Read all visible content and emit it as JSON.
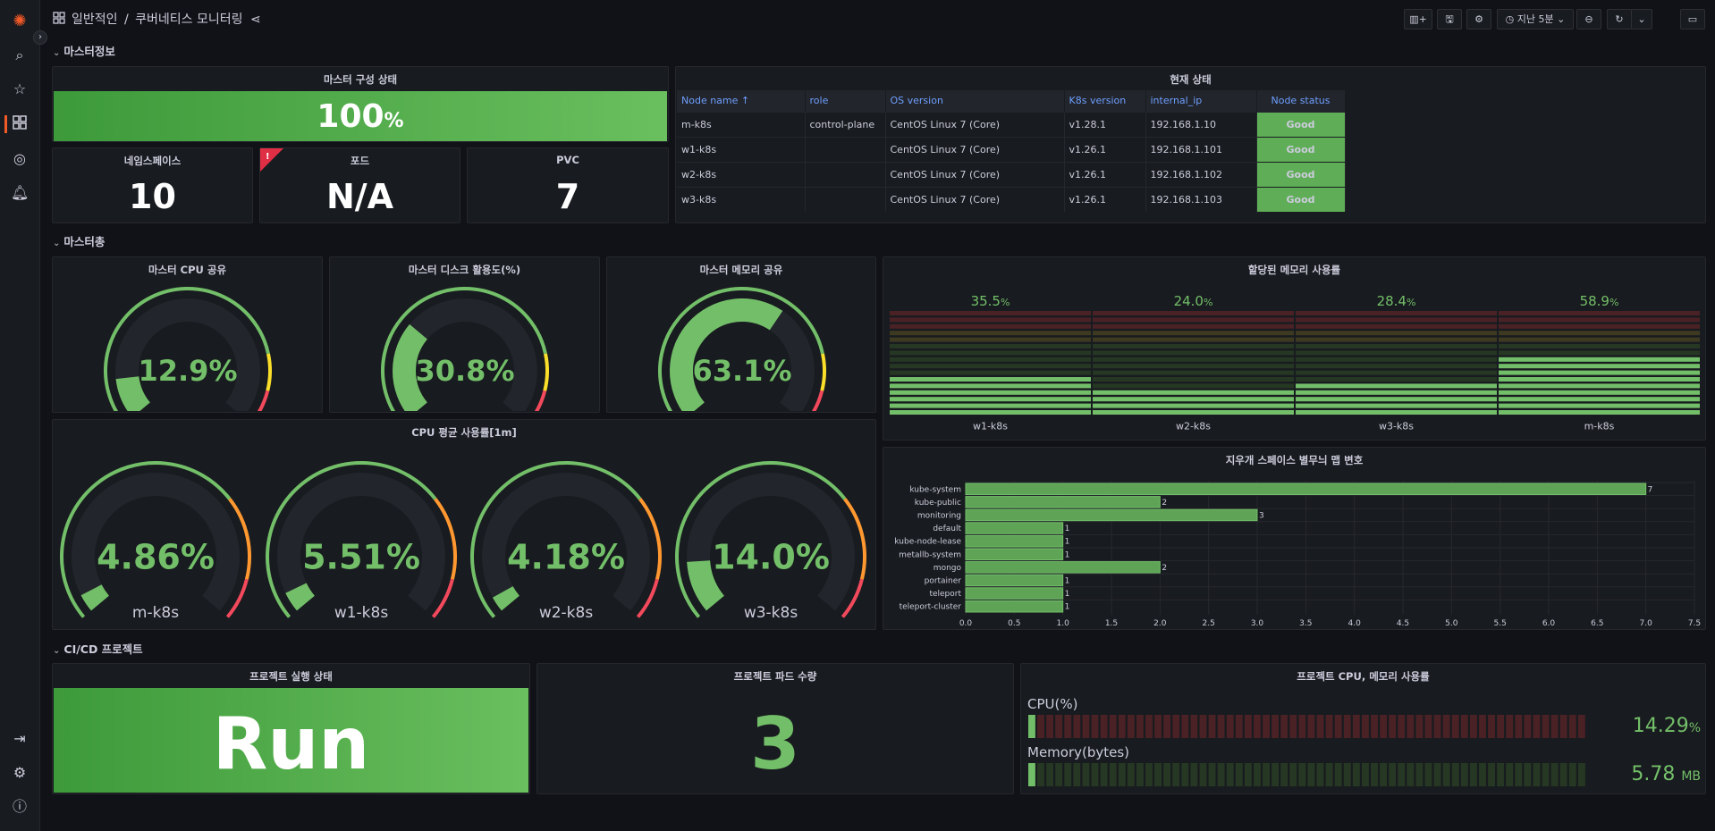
{
  "breadcrumb": {
    "folder": "일반적인",
    "separator": "/",
    "dashboard": "쿠버네티스 모니터링"
  },
  "toolbar": {
    "time_range": "지난 5분"
  },
  "rows": {
    "master_info": "마스터정보",
    "master_total": "마스터총",
    "cicd": "CI/CD 프로젝트"
  },
  "master_status": {
    "title": "마스터 구성 상태",
    "value": "100",
    "unit": "%"
  },
  "namespace": {
    "title": "네임스페이스",
    "value": "10"
  },
  "pod": {
    "title": "포드",
    "value": "N/A"
  },
  "pvc": {
    "title": "PVC",
    "value": "7"
  },
  "current_status": {
    "title": "현재 상태",
    "columns": [
      "Node name ↑",
      "role",
      "OS version",
      "K8s version",
      "internal_ip",
      "Node status"
    ],
    "rows": [
      [
        "m-k8s",
        "control-plane",
        "CentOS Linux 7 (Core)",
        "v1.28.1",
        "192.168.1.10",
        "Good"
      ],
      [
        "w1-k8s",
        "",
        "CentOS Linux 7 (Core)",
        "v1.26.1",
        "192.168.1.101",
        "Good"
      ],
      [
        "w2-k8s",
        "",
        "CentOS Linux 7 (Core)",
        "v1.26.1",
        "192.168.1.102",
        "Good"
      ],
      [
        "w3-k8s",
        "",
        "CentOS Linux 7 (Core)",
        "v1.26.1",
        "192.168.1.103",
        "Good"
      ]
    ]
  },
  "gauges_small": [
    {
      "title": "마스터 CPU 공유",
      "value": 12.9,
      "label": "12.9%"
    },
    {
      "title": "마스터 디스크 활용도(%)",
      "value": 30.8,
      "label": "30.8%"
    },
    {
      "title": "마스터 메모리 공유",
      "value": 63.1,
      "label": "63.1%"
    }
  ],
  "cpu_avg": {
    "title": "CPU 평균 사용률[1m]",
    "gauges": [
      {
        "value": 4.86,
        "label": "4.86%",
        "name": "m-k8s"
      },
      {
        "value": 5.51,
        "label": "5.51%",
        "name": "w1-k8s"
      },
      {
        "value": 4.18,
        "label": "4.18%",
        "name": "w2-k8s"
      },
      {
        "value": 14.0,
        "label": "14.0%",
        "name": "w3-k8s"
      }
    ]
  },
  "mem_alloc": {
    "title": "할당된 메모리 사용률",
    "bars": [
      {
        "name": "w1-k8s",
        "value": 35.5,
        "num": "35.5",
        "unit": "%"
      },
      {
        "name": "w2-k8s",
        "value": 24.0,
        "num": "24.0",
        "unit": "%"
      },
      {
        "name": "w3-k8s",
        "value": 28.4,
        "num": "28.4",
        "unit": "%"
      },
      {
        "name": "m-k8s",
        "value": 58.9,
        "num": "58.9",
        "unit": "%"
      }
    ]
  },
  "chart_data": {
    "type": "bar",
    "orientation": "horizontal",
    "title": "지우개 스페이스 별무늬 맵 변호",
    "categories": [
      "kube-system",
      "kube-public",
      "monitoring",
      "default",
      "kube-node-lease",
      "metallb-system",
      "mongo",
      "portainer",
      "teleport",
      "teleport-cluster"
    ],
    "values": [
      7,
      2,
      3,
      1,
      1,
      1,
      2,
      1,
      1,
      1
    ],
    "xlim": [
      0,
      7.5
    ],
    "xticks": [
      "0.0",
      "0.5",
      "1.0",
      "1.5",
      "2.0",
      "2.5",
      "3.0",
      "3.5",
      "4.0",
      "4.5",
      "5.0",
      "5.5",
      "6.0",
      "6.5",
      "7.0",
      "7.5"
    ],
    "grid": true
  },
  "project_run": {
    "title": "프로젝트 실행 상태",
    "value": "Run"
  },
  "project_pods": {
    "title": "프로젝트 파드 수량",
    "value": "3"
  },
  "project_usage": {
    "title": "프로젝트 CPU, 메모리 사용률",
    "cpu_label": "CPU(%)",
    "cpu_value": "14.29",
    "cpu_unit": "%",
    "cpu_fraction": 0.0143,
    "mem_label": "Memory(bytes)",
    "mem_value": "5.78",
    "mem_unit": "MB",
    "mem_fraction": 0.01
  },
  "colors": {
    "green": "#73bf69",
    "yellow": "#fade2a",
    "orange": "#ff9830",
    "red": "#f2495c",
    "brand": "#f05a28"
  }
}
